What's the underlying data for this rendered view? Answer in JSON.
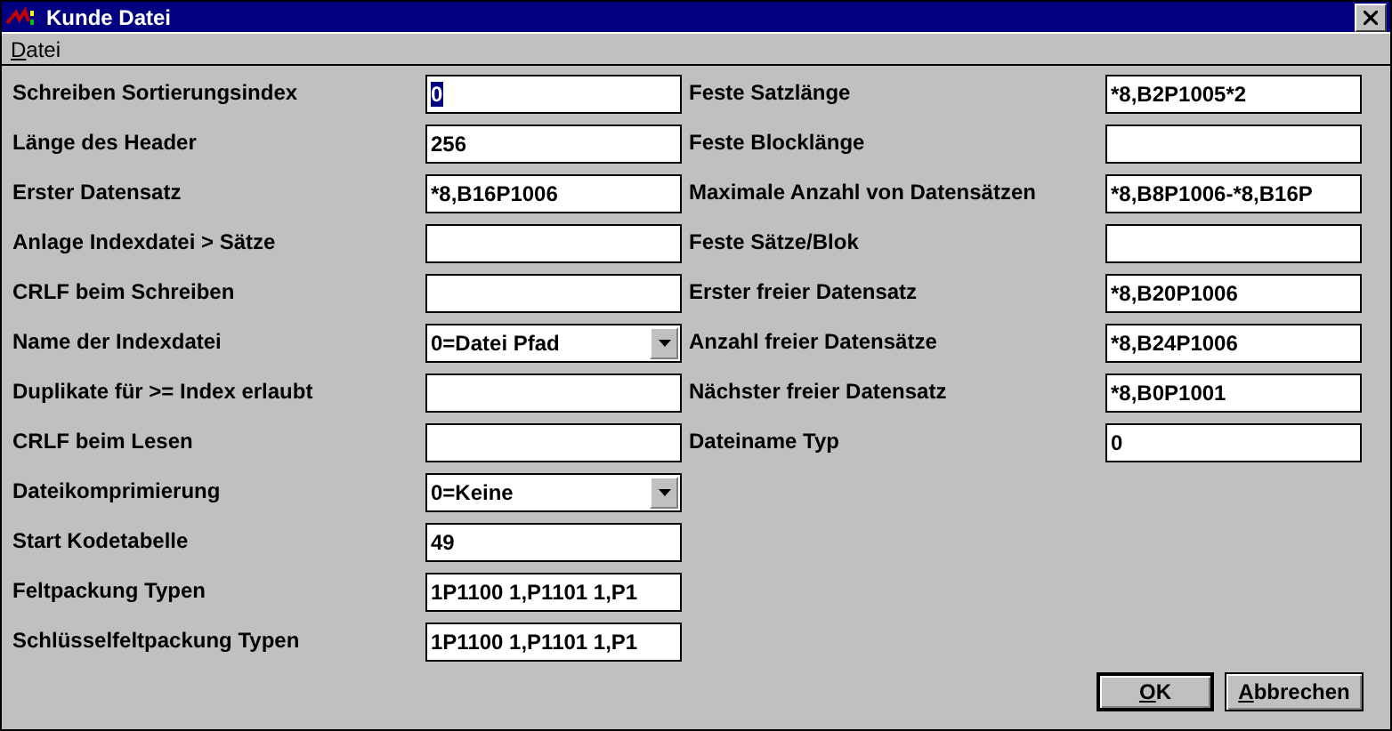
{
  "window": {
    "title": "Kunde Datei"
  },
  "menu": [
    {
      "label": "Datei"
    }
  ],
  "left_fields": [
    {
      "label": "Schreiben Sortierungsindex",
      "kind": "text",
      "value": "0",
      "highlighted": true
    },
    {
      "label": "Länge des Header",
      "kind": "text",
      "value": "256",
      "highlighted": false
    },
    {
      "label": "Erster Datensatz",
      "kind": "text",
      "value": "*8,B16P1006",
      "highlighted": false
    },
    {
      "label": "Anlage Indexdatei > Sätze",
      "kind": "text",
      "highlighted": false
    },
    {
      "label": "CRLF beim Schreiben",
      "kind": "text",
      "highlighted": false
    },
    {
      "label": "Name der Indexdatei",
      "kind": "dropdown",
      "value": "0=Datei Pfad",
      "highlighted": false
    },
    {
      "label": "Duplikate für >= Index erlaubt",
      "kind": "text",
      "highlighted": false
    },
    {
      "label": "CRLF beim Lesen",
      "kind": "text",
      "highlighted": false
    },
    {
      "label": "Dateikomprimierung",
      "kind": "dropdown",
      "value": "0=Keine",
      "highlighted": false
    },
    {
      "label": "Start Kodetabelle",
      "kind": "text",
      "value": "49",
      "highlighted": false
    },
    {
      "label": "Feltpackung Typen",
      "kind": "text",
      "value": "1P1100 1,P1101 1,P1",
      "highlighted": false
    },
    {
      "label": "Schlüsselfeltpackung Typen",
      "kind": "text",
      "value": "1P1100 1,P1101 1,P1",
      "highlighted": false
    }
  ],
  "right_fields": [
    {
      "label": "Feste Satzlänge",
      "kind": "text",
      "value": "*8,B2P1005*2",
      "highlighted": false
    },
    {
      "label": "Feste Blocklänge",
      "kind": "text",
      "highlighted": false
    },
    {
      "label": "Maximale Anzahl von Datensätzen",
      "kind": "text",
      "value": "*8,B8P1006-*8,B16P",
      "highlighted": false
    },
    {
      "label": "Feste Sätze/Blok",
      "kind": "text",
      "highlighted": false
    },
    {
      "label": "Erster freier Datensatz",
      "kind": "text",
      "value": "*8,B20P1006",
      "highlighted": false
    },
    {
      "label": "Anzahl freier Datensätze",
      "kind": "text",
      "value": "*8,B24P1006",
      "highlighted": false
    },
    {
      "label": "Nächster freier Datensatz",
      "kind": "text",
      "value": "*8,B0P1001",
      "highlighted": false
    },
    {
      "label": "Dateiname Typ",
      "kind": "text",
      "value": "0",
      "highlighted": false
    }
  ],
  "buttons": [
    {
      "label": "OK",
      "default": true
    },
    {
      "label": "Abbrechen",
      "default": false
    }
  ]
}
